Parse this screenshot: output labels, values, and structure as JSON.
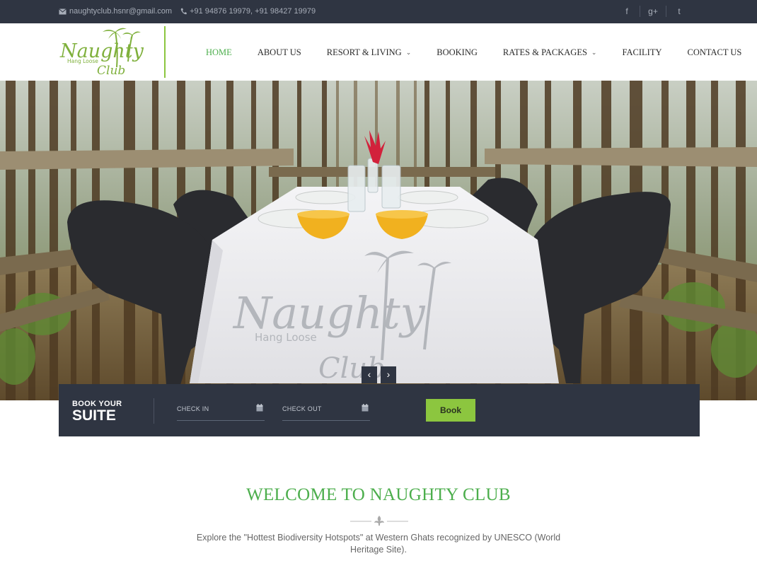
{
  "topbar": {
    "email": "naughtyclub.hsnr@gmail.com",
    "phone": "+91  94876  19979, +91  98427  19979",
    "social": [
      "facebook-icon",
      "google-plus-icon",
      "twitter-icon"
    ],
    "social_glyphs": [
      "f",
      "g+",
      "t"
    ]
  },
  "logo": {
    "text_main": "Naughty",
    "text_sub": "Hang Loose",
    "text_club": "Club"
  },
  "nav": {
    "items": [
      {
        "label": "HOME",
        "active": true
      },
      {
        "label": "ABOUT US"
      },
      {
        "label": "RESORT & LIVING",
        "dropdown": true
      },
      {
        "label": "BOOKING"
      },
      {
        "label": "RATES & PACKAGES",
        "dropdown": true
      },
      {
        "label": "FACILITY"
      },
      {
        "label": "CONTACT US"
      }
    ]
  },
  "hero": {
    "watermark_main": "Naughty",
    "watermark_sub": "Hang Loose",
    "watermark_club": "Club",
    "prev": "‹",
    "next": "›"
  },
  "booking": {
    "title_small": "BOOK YOUR",
    "title_big": "SUITE",
    "checkin_label": "CHECK IN",
    "checkout_label": "CHECK OUT",
    "book_label": "Book"
  },
  "welcome": {
    "title": "WELCOME TO NAUGHTY CLUB",
    "intro": "Explore the \"Hottest Biodiversity Hotspots\" at Western Ghats recognized by UNESCO (World Heritage Site)."
  },
  "colors": {
    "dark_bar": "#2f3542",
    "accent_green": "#8cc63f",
    "heading_green": "#4cae4c"
  }
}
